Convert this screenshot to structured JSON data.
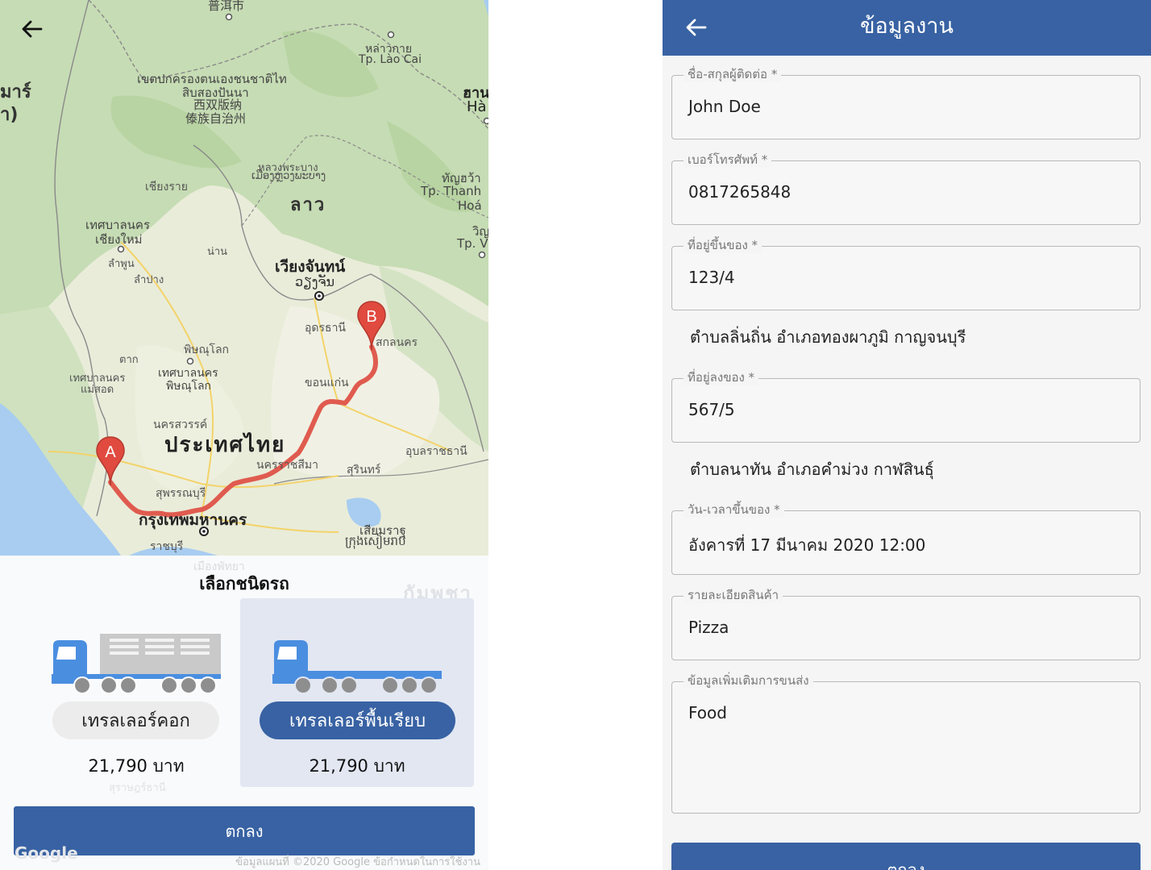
{
  "left_screen": {
    "map": {
      "labels": {
        "pu_er": "普洱市",
        "myanmar_a": "มาร์",
        "myanmar_b": "า)",
        "xishuangbanna_th1": "เขตปกครองตนเองชนชาติไท",
        "xishuangbanna_th2": "สิบสองปันนา",
        "xishuangbanna_zh1": "西双版纳",
        "xishuangbanna_zh2": "傣族自治州",
        "lao_cai_th": "หล่าวกาย",
        "lao_cai": "Tp. Lào Cai",
        "hanoi_th": "ฮาน",
        "hanoi": "Hà",
        "chiang_rai": "เชียงราย",
        "luang_prabang_th": "หลวงพระบาง",
        "luang_prabang_lo": "ເມືອງຫຼວງພະບາງ",
        "laos": "ลาว",
        "thanh_hoa_th": "ทัญฮว้า",
        "thanh_hoa1": "Tp. Thanh",
        "thanh_hoa2": "Hoá",
        "vinh_th": "วิญ",
        "vinh": "Tp. V",
        "chiang_mai1": "เทศบาลนคร",
        "chiang_mai2": "เชียงใหม่",
        "lamphun": "ลำพูน",
        "lampang": "ลำปาง",
        "nan": "น่าน",
        "vientiane_th": "เวียงจันทน์",
        "vientiane_lo": "ວຽງຈັນ",
        "udon": "อุดรธานี",
        "sakon": "สกลนคร",
        "tak": "ตาก",
        "mae_sot1": "เทศบาลนคร",
        "mae_sot2": "แม่สอด",
        "phitsanulok": "พิษณุโลก",
        "phitsanulok_city1": "เทศบาลนคร",
        "phitsanulok_city2": "พิษณุโลก",
        "khon_kaen": "ขอนแก่น",
        "nakhon_sawan": "นครสวรรค์",
        "thailand": "ประเทศไทย",
        "ubon": "อุบลราชธานี",
        "korat": "นครราชสีมา",
        "surin": "สุรินทร์",
        "suphan": "สุพรรณบุรี",
        "bangkok": "กรุงเทพมหานคร",
        "siem_reap_th": "เสียมราฐ",
        "siem_reap_km": "ក្រុងសៀមរាប",
        "ratchaburi": "ราชบุรี",
        "pattaya": "เมืองพัทยา",
        "cambodia": "กัมพูชา",
        "surat": "สุราษฎร์ธานี"
      },
      "marker_a": "A",
      "marker_b": "B",
      "footer": "ข้อมูลแผนที่ ©2020 Google   ข้อกำหนดในการใช้งาน",
      "google_logo": "Google"
    },
    "sheet_title": "เลือกชนิดรถ",
    "vehicles": [
      {
        "name": "เทรลเลอร์คอก",
        "price": "21,790 บาท",
        "selected": false
      },
      {
        "name": "เทรลเลอร์พื้นเรียบ",
        "price": "21,790 บาท",
        "selected": true
      }
    ],
    "ok_button": "ตกลง",
    "colors": {
      "primary": "#3862a3",
      "route": "#e05b4f",
      "truck": "#4a8ee0"
    }
  },
  "right_screen": {
    "title": "ข้อมูลงาน",
    "fields": [
      {
        "label": "ชื่อ-สกุลผู้ติดต่อ *",
        "value": "John Doe"
      },
      {
        "label": "เบอร์โทรศัพท์ *",
        "value": "0817265848"
      },
      {
        "label": "ที่อยู่ขึ้นของ *",
        "value": "123/4"
      },
      {
        "label": "ที่อยู่ลงของ *",
        "value": "567/5"
      },
      {
        "label": "วัน-เวลาขึ้นของ *",
        "value": "อังคารที่ 17 มีนาคม 2020 12:00"
      },
      {
        "label": "รายละเอียดสินค้า",
        "value": "Pizza"
      },
      {
        "label": "ข้อมูลเพิ่มเติมการขนส่ง",
        "value": "Food"
      }
    ],
    "pickup_area": "ตำบลลิ่นถิ่น อำเภอทองผาภูมิ กาญจนบุรี",
    "dropoff_area": "ตำบลนาทัน อำเภอคำม่วง กาฬสินธุ์",
    "ok_button": "ตกลง"
  }
}
